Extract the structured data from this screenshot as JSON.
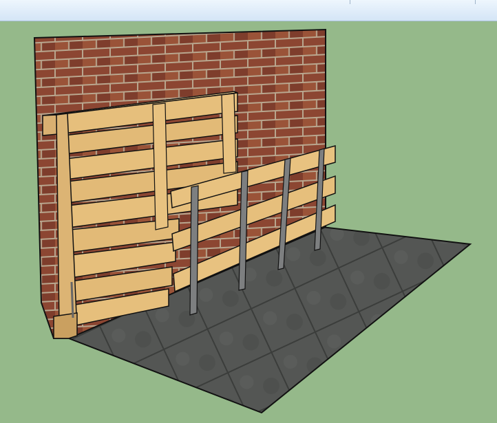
{
  "window": {
    "toolbar_strip": "toolbar-strip"
  },
  "viewport": {
    "background_color": "#95b98a",
    "scene": {
      "objects": [
        "brick-wall",
        "paving-floor",
        "vertical-pallet",
        "leaning-slat-rack",
        "metal-brackets"
      ],
      "colors": {
        "brick": "#8c4632",
        "mortar": "#b9a78f",
        "wood": "#e6bf7c",
        "floor": "#505250",
        "metal": "#7d7f80",
        "edge": "#111111"
      }
    }
  }
}
